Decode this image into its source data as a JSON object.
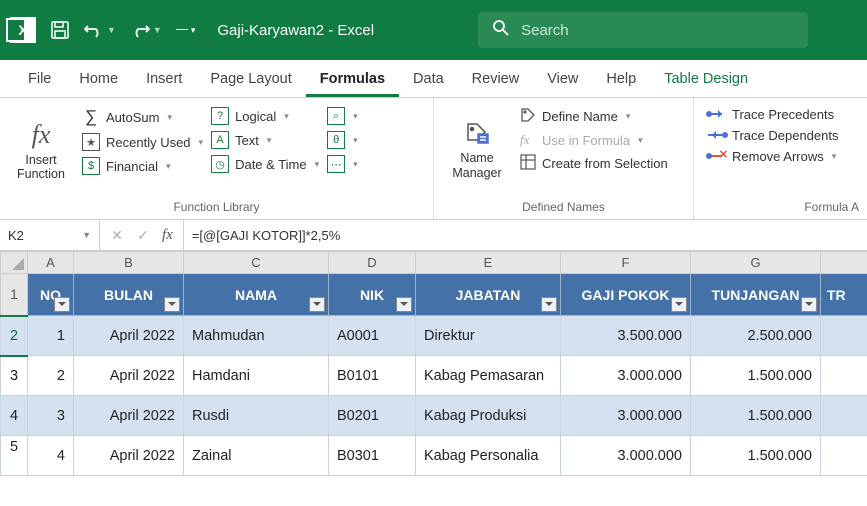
{
  "titlebar": {
    "app_icon_letter": "X",
    "title": "Gaji-Karyawan2  -  Excel",
    "search_placeholder": "Search"
  },
  "tabs": {
    "file": "File",
    "home": "Home",
    "insert": "Insert",
    "page_layout": "Page Layout",
    "formulas": "Formulas",
    "data": "Data",
    "review": "Review",
    "view": "View",
    "help": "Help",
    "table_design": "Table Design"
  },
  "ribbon": {
    "insert_function": "Insert Function",
    "autosum": "AutoSum",
    "recently_used": "Recently Used",
    "financial": "Financial",
    "logical": "Logical",
    "text": "Text",
    "date_time": "Date & Time",
    "group_library": "Function Library",
    "name_manager": "Name Manager",
    "define_name": "Define Name",
    "use_in_formula": "Use in Formula",
    "create_selection": "Create from Selection",
    "group_defined": "Defined Names",
    "trace_prec": "Trace Precedents",
    "trace_dep": "Trace Dependents",
    "remove_arrows": "Remove Arrows",
    "group_audit": "Formula A"
  },
  "namebox": {
    "ref": "K2"
  },
  "formula": {
    "text": "=[@[GAJI KOTOR]]*2,5%"
  },
  "columns": {
    "A": "A",
    "B": "B",
    "C": "C",
    "D": "D",
    "E": "E",
    "F": "F",
    "G": "G"
  },
  "headers": {
    "no": "NO",
    "bulan": "BULAN",
    "nama": "NAMA",
    "nik": "NIK",
    "jabatan": "JABATAN",
    "gaji_pokok": "GAJI POKOK",
    "tunjangan": "TUNJANGAN",
    "tr": "TR"
  },
  "rows": [
    {
      "rn": "1",
      "no": "1",
      "bulan": "April 2022",
      "nama": "Mahmudan",
      "nik": "A0001",
      "jabatan": "Direktur",
      "gaji": "3.500.000",
      "tunj": "2.500.000"
    },
    {
      "rn": "2",
      "no": "2",
      "bulan": "April 2022",
      "nama": "Hamdani",
      "nik": "B0101",
      "jabatan": "Kabag Pemasaran",
      "gaji": "3.000.000",
      "tunj": "1.500.000"
    },
    {
      "rn": "3",
      "no": "3",
      "bulan": "April 2022",
      "nama": "Rusdi",
      "nik": "B0201",
      "jabatan": "Kabag Produksi",
      "gaji": "3.000.000",
      "tunj": "1.500.000"
    },
    {
      "rn": "4",
      "no": "4",
      "bulan": "April 2022",
      "nama": "Zainal",
      "nik": "B0301",
      "jabatan": "Kabag Personalia",
      "gaji": "3.000.000",
      "tunj": "1.500.000"
    }
  ],
  "rowlabels": {
    "r1": "1",
    "r2": "2",
    "r3": "3",
    "r4": "4",
    "r5": "5"
  }
}
